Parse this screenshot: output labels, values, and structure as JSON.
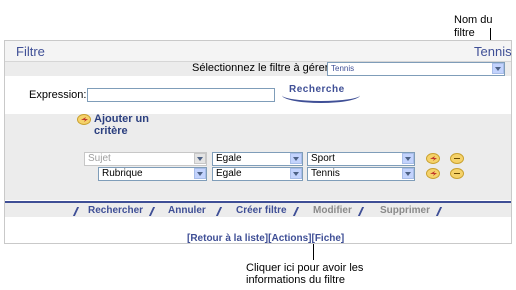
{
  "callouts": {
    "filter_name_label": "Nom du filtre",
    "info_label_line1": "Cliquer ici pour avoir les",
    "info_label_line2": "informations du filtre"
  },
  "header": {
    "title": "Filtre",
    "filter_name": "Tennis"
  },
  "select_filter": {
    "label": "Sélectionnez le filtre à gérer",
    "value": "Tennis"
  },
  "search": {
    "label": "Expression:",
    "value": "",
    "button_label": "Recherche"
  },
  "add_criterion": {
    "label": "Ajouter un critère"
  },
  "criteria": [
    {
      "field": "Sujet",
      "field_disabled": true,
      "operator": "Egale",
      "value": "Sport"
    },
    {
      "field": "Rubrique",
      "field_disabled": false,
      "operator": "Egale",
      "value": "Tennis"
    }
  ],
  "toolbar": {
    "rechercher": "Rechercher",
    "annuler": "Annuler",
    "creer": "Créer filtre",
    "modifier": "Modifier",
    "supprimer": "Supprimer"
  },
  "links": {
    "retour": "[Retour à la liste]",
    "actions": "[Actions]",
    "fiche": "[Fiche]"
  },
  "colors": {
    "accent": "#3f4f96",
    "band": "#ececec",
    "disabled": "#8a8a8a"
  }
}
